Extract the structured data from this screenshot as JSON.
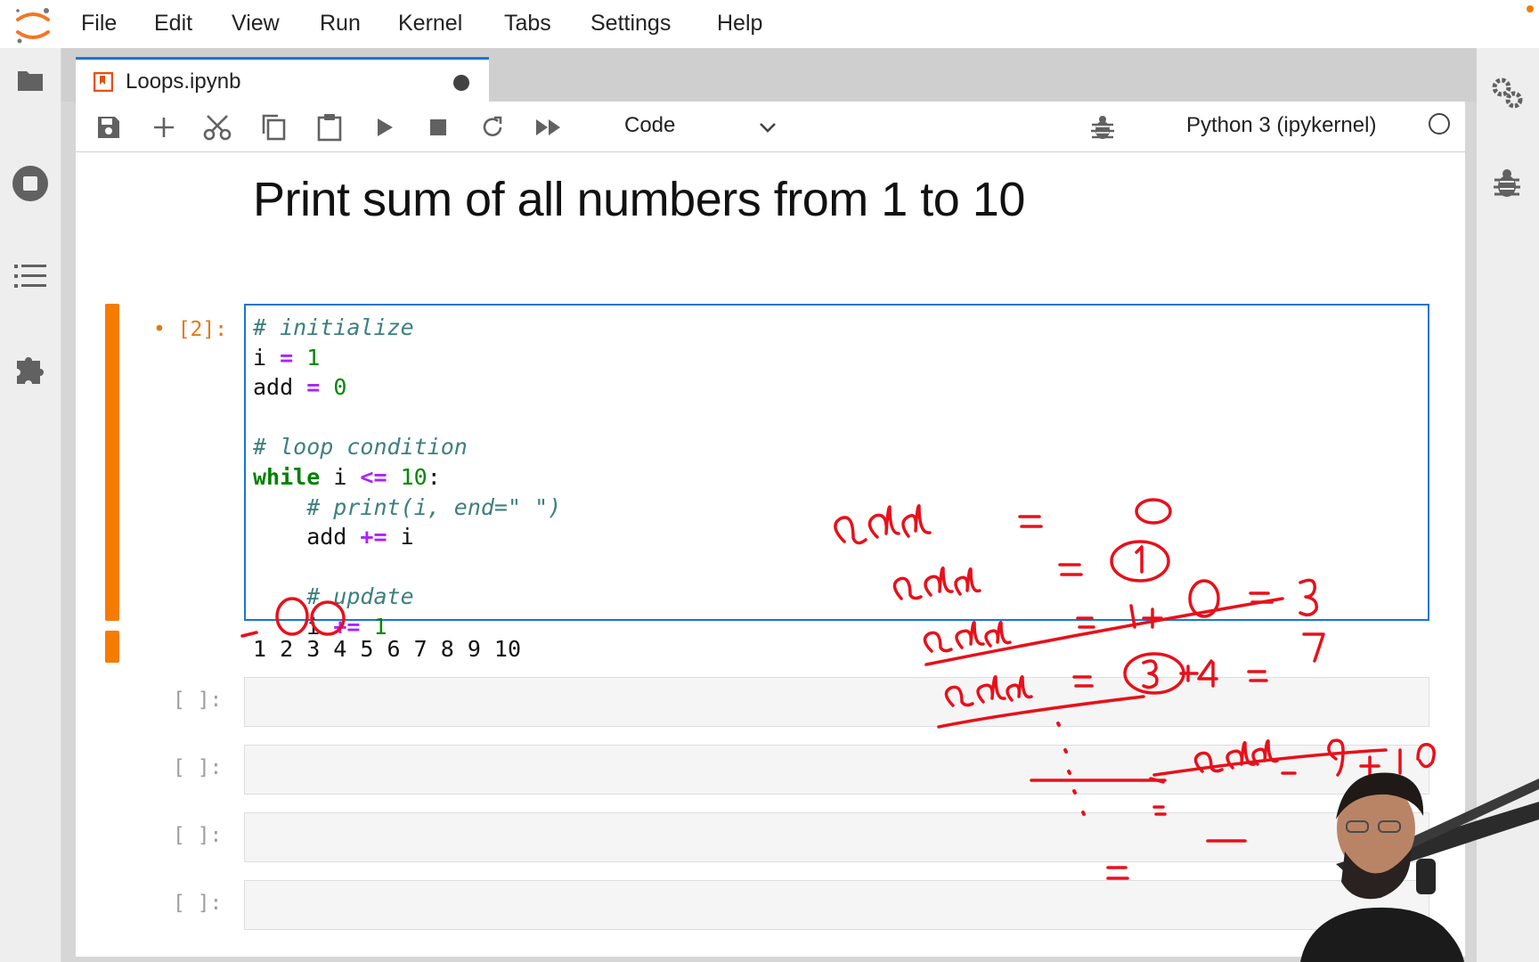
{
  "menubar": {
    "items": [
      "File",
      "Edit",
      "View",
      "Run",
      "Kernel",
      "Tabs",
      "Settings",
      "Help"
    ]
  },
  "sidebar_left": {
    "icons": [
      "folder-icon",
      "running-icon",
      "toc-icon",
      "extension-icon"
    ]
  },
  "sidebar_right": {
    "icons": [
      "property-inspector-icon",
      "debugger-icon"
    ]
  },
  "tab": {
    "label": "Loops.ipynb",
    "dirty": true
  },
  "toolbar": {
    "buttons": [
      "save-icon",
      "add-icon",
      "cut-icon",
      "copy-icon",
      "paste-icon",
      "run-icon",
      "stop-icon",
      "restart-icon",
      "fast-forward-icon"
    ],
    "cell_type": "Code",
    "kernel_name": "Python 3 (ipykernel)"
  },
  "notebook": {
    "heading": "Print sum of all numbers from 1 to 10",
    "cell1": {
      "prompt": "[2]:",
      "code_lines": [
        "# initialize",
        "i = 1",
        "add = 0",
        "",
        "# loop condition",
        "while i <= 10:",
        "    # print(i, end=\" \")",
        "    add += i",
        "",
        "    # update",
        "    i += 1"
      ],
      "output": "1 2 3 4 5 6 7 8 9 10"
    },
    "empty_cells": [
      {
        "prompt": "[ ]:"
      },
      {
        "prompt": "[ ]:"
      },
      {
        "prompt": "[ ]:"
      },
      {
        "prompt": "[ ]:"
      }
    ]
  },
  "colors": {
    "accent": "#1976d2",
    "collapser": "#f57c00",
    "prompt_active": "#e07a11",
    "annotation": "#e8101a"
  }
}
